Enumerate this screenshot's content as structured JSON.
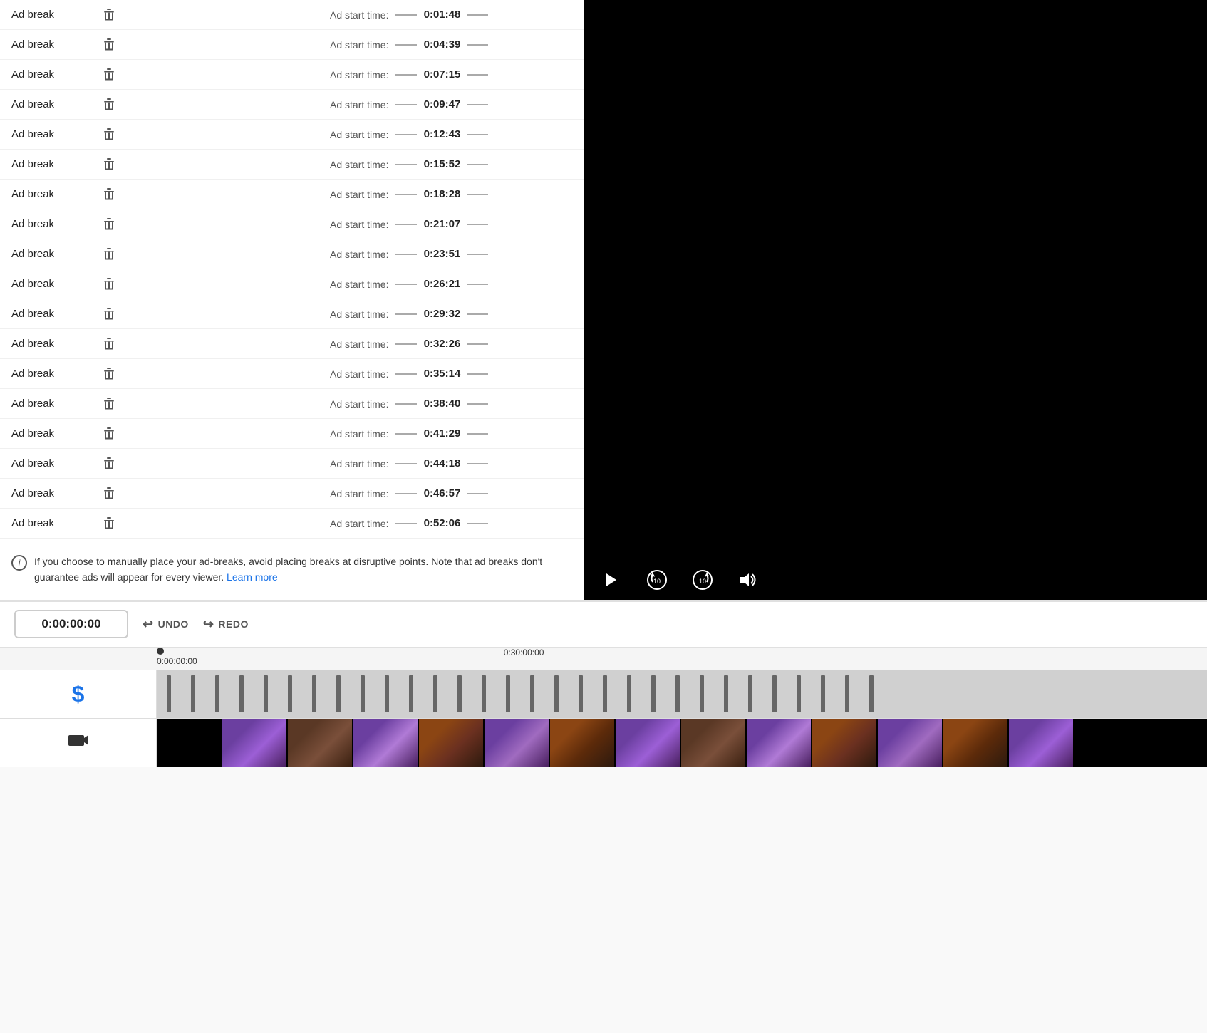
{
  "adBreaks": [
    {
      "label": "Ad break",
      "time": "0:01:48"
    },
    {
      "label": "Ad break",
      "time": "0:04:39"
    },
    {
      "label": "Ad break",
      "time": "0:07:15"
    },
    {
      "label": "Ad break",
      "time": "0:09:47"
    },
    {
      "label": "Ad break",
      "time": "0:12:43"
    },
    {
      "label": "Ad break",
      "time": "0:15:52"
    },
    {
      "label": "Ad break",
      "time": "0:18:28"
    },
    {
      "label": "Ad break",
      "time": "0:21:07"
    },
    {
      "label": "Ad break",
      "time": "0:23:51"
    },
    {
      "label": "Ad break",
      "time": "0:26:21"
    },
    {
      "label": "Ad break",
      "time": "0:29:32"
    },
    {
      "label": "Ad break",
      "time": "0:32:26"
    },
    {
      "label": "Ad break",
      "time": "0:35:14"
    },
    {
      "label": "Ad break",
      "time": "0:38:40"
    },
    {
      "label": "Ad break",
      "time": "0:41:29"
    },
    {
      "label": "Ad break",
      "time": "0:44:18"
    },
    {
      "label": "Ad break",
      "time": "0:46:57"
    },
    {
      "label": "Ad break",
      "time": "0:52:06"
    }
  ],
  "adStartLabel": "Ad start time:",
  "infoText": "If you choose to manually place your ad-breaks, avoid placing breaks at disruptive points. Note that ad breaks don't guarantee ads will appear for every viewer.",
  "learnMoreLabel": "Learn more",
  "timeDisplay": "0:00:00:00",
  "undoLabel": "UNDO",
  "redoLabel": "REDO",
  "rulerStart": "0:00:00:00",
  "rulerMid": "0:30:00:00",
  "videoControls": {
    "play": "▶",
    "rewind": "↺",
    "forward": "↻",
    "volume": "🔊"
  },
  "markers": [
    1,
    2,
    3,
    4,
    5,
    6,
    7,
    8,
    9,
    10,
    11,
    12,
    13,
    14,
    15,
    16,
    17,
    18,
    19,
    20,
    21,
    22,
    23,
    24,
    25,
    26,
    27,
    28,
    29,
    30
  ]
}
